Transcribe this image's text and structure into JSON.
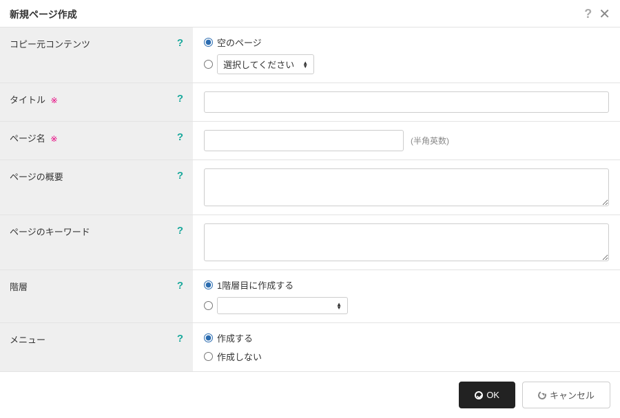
{
  "dialog": {
    "title": "新規ページ作成"
  },
  "fields": {
    "copySource": {
      "label": "コピー元コンテンツ",
      "option1": "空のページ",
      "option2_placeholder": "選択してください"
    },
    "title": {
      "label": "タイトル",
      "required": "※"
    },
    "pageName": {
      "label": "ページ名",
      "required": "※",
      "hint": "(半角英数)"
    },
    "summary": {
      "label": "ページの概要"
    },
    "keywords": {
      "label": "ページのキーワード"
    },
    "hierarchy": {
      "label": "階層",
      "option1": "1階層目に作成する"
    },
    "menu": {
      "label": "メニュー",
      "option1": "作成する",
      "option2": "作成しない"
    }
  },
  "footer": {
    "ok": "OK",
    "cancel": "キャンセル"
  }
}
